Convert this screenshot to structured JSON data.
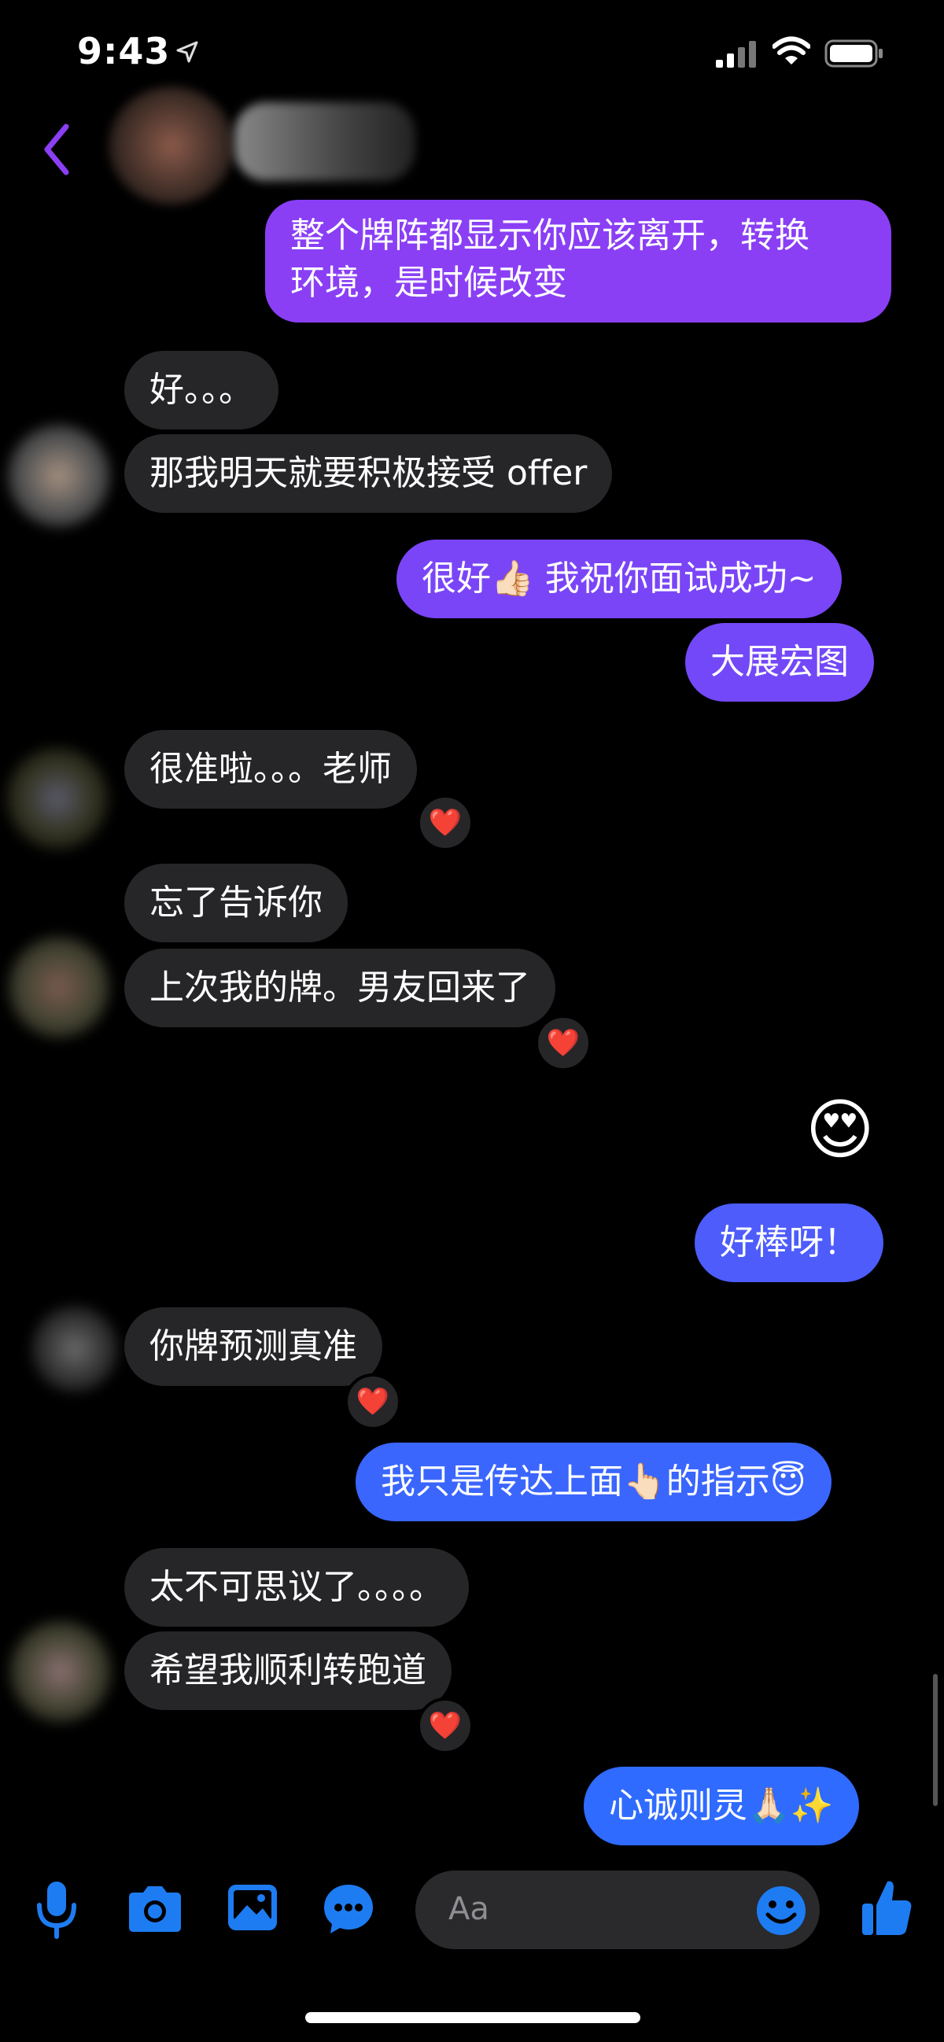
{
  "status_bar": {
    "time": "9:43"
  },
  "messages": [
    {
      "side": "out",
      "text": "整个牌阵都显示你应该离开，转换",
      "text2": "环境，是时候改变"
    },
    {
      "side": "in",
      "text": "好。。。"
    },
    {
      "side": "in",
      "text": "那我明天就要积极接受 offer"
    },
    {
      "side": "out",
      "text": "很好👍🏻 我祝你面试成功~"
    },
    {
      "side": "out",
      "text": "大展宏图"
    },
    {
      "side": "in",
      "text": "很准啦。。。老师",
      "reaction": "❤️"
    },
    {
      "side": "in",
      "text": "忘了告诉你"
    },
    {
      "side": "in",
      "text": "上次我的牌。男友回来了",
      "reaction": "❤️"
    },
    {
      "side": "out",
      "text": "😍"
    },
    {
      "side": "out",
      "text": "好棒呀！"
    },
    {
      "side": "in",
      "text": "你牌预测真准",
      "reaction": "❤️"
    },
    {
      "side": "out",
      "text": "我只是传达上面👆🏻的指示😇"
    },
    {
      "side": "in",
      "text": "太不可思议了。。。。"
    },
    {
      "side": "in",
      "text": "希望我顺利转跑道",
      "reaction": "❤️"
    },
    {
      "side": "out",
      "text": "心诚则灵🙏🏻✨"
    }
  ],
  "composer": {
    "placeholder": "Aa"
  },
  "colors": {
    "accent": "#7c4dff",
    "outgoing_top": "#8a3ff5",
    "outgoing_bottom": "#2f6bff",
    "incoming": "#262628",
    "icon": "#1e7cf2"
  },
  "icons": [
    "microphone-icon",
    "camera-icon",
    "gallery-icon",
    "chat-bubble-icon",
    "emoji-icon",
    "thumbs-up-icon",
    "back-icon"
  ]
}
